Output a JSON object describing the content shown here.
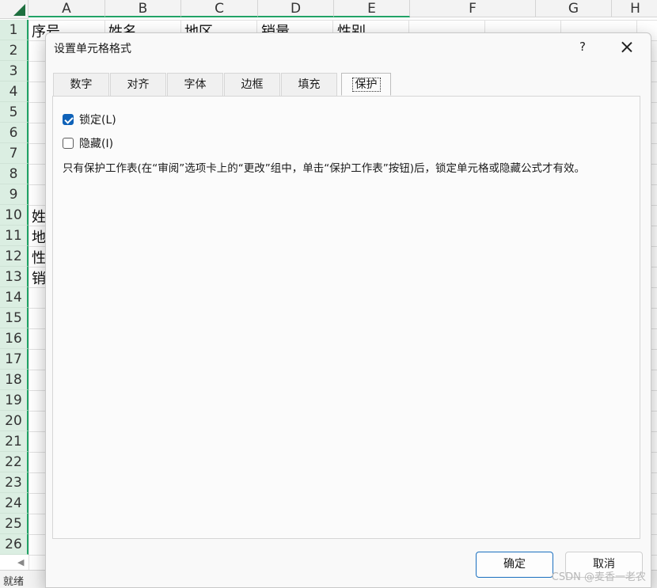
{
  "spreadsheet": {
    "columns": [
      "A",
      "B",
      "C",
      "D",
      "E",
      "F",
      "G",
      "H"
    ],
    "rows": [
      "1",
      "2",
      "3",
      "4",
      "5",
      "6",
      "7",
      "8",
      "9",
      "10",
      "11",
      "12",
      "13",
      "14",
      "15",
      "16",
      "17",
      "18",
      "19",
      "20",
      "21",
      "22",
      "23",
      "24",
      "25",
      "26"
    ],
    "row1_cells": [
      "序号",
      "姓名",
      "地区",
      "销量",
      "性别"
    ],
    "col_a_cells": {
      "r10": "姓",
      "r11": "地",
      "r12": "性",
      "r13": "销"
    },
    "status_text": "就绪"
  },
  "dialog": {
    "title": "设置单元格格式",
    "help_label": "?",
    "tabs": [
      "数字",
      "对齐",
      "字体",
      "边框",
      "填充",
      "保护"
    ],
    "active_tab": "保护",
    "locked": {
      "label": "锁定(L)",
      "checked": true
    },
    "hidden": {
      "label": "隐藏(I)",
      "checked": false
    },
    "note": "只有保护工作表(在“审阅”选项卡上的“更改”组中，单击“保护工作表”按钮)后，锁定单元格或隐藏公式才有效。",
    "ok_label": "确定",
    "cancel_label": "取消"
  },
  "watermark": "CSDN @麦香一老农",
  "colors": {
    "accent_green": "#21a366",
    "checkbox_blue": "#0f62b8",
    "primary_border": "#1a6fbf"
  }
}
